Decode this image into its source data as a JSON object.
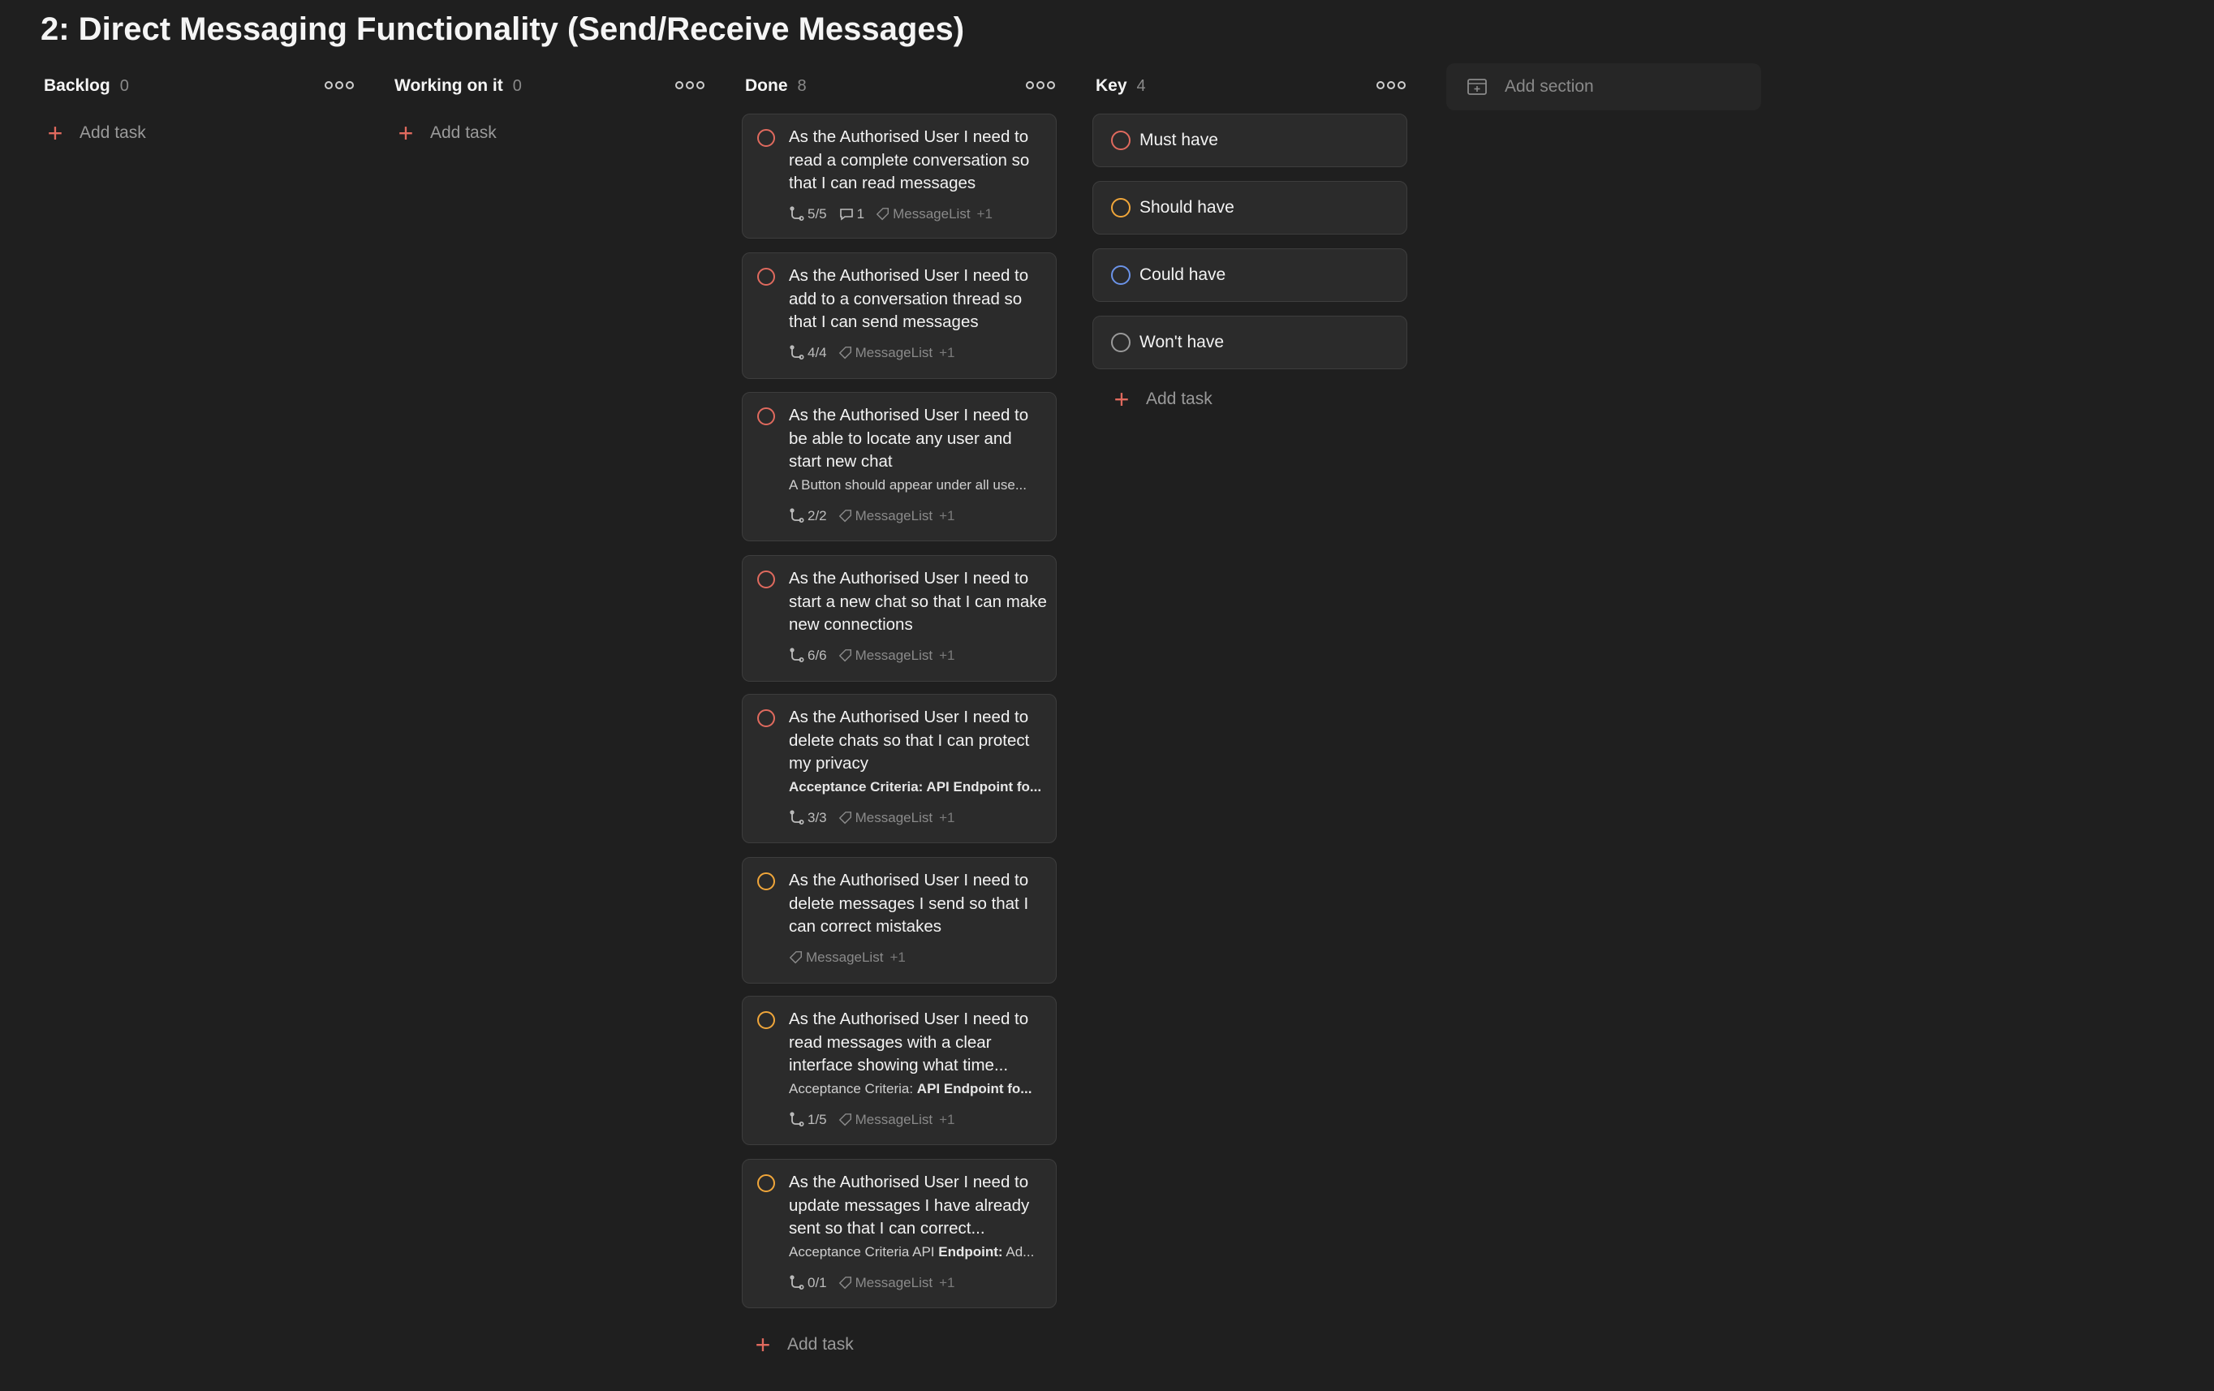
{
  "project": {
    "title": "2: Direct Messaging Functionality (Send/Receive Messages)"
  },
  "add_task_label": "Add task",
  "add_section_label": "Add section",
  "colors": {
    "must": "#e06a5e",
    "should": "#f0a63a",
    "could": "#6b93e8",
    "wont": "#9a9a9a",
    "add_plus": "#e06a5e"
  },
  "columns": [
    {
      "name": "Backlog",
      "count": "0"
    },
    {
      "name": "Working on it",
      "count": "0"
    },
    {
      "name": "Done",
      "count": "8"
    },
    {
      "name": "Key",
      "count": "4"
    }
  ],
  "cards": [
    {
      "title": "As the Authorised User I need to read a complete conversation so that I can read messages",
      "subtasks": "5/5",
      "comments": "1",
      "tag": "MessageList",
      "more": "+1",
      "priority": "must"
    },
    {
      "title": "As the Authorised User I need to add to a conversation thread so that I can send messages",
      "subtasks": "4/4",
      "tag": "MessageList",
      "more": "+1",
      "priority": "must"
    },
    {
      "title": "As the Authorised User I need to be able to locate any user and start new chat",
      "desc": "A Button should appear under all use...",
      "subtasks": "2/2",
      "tag": "MessageList",
      "more": "+1",
      "priority": "must"
    },
    {
      "title": "As the Authorised User I need to start a new chat so that I can make new connections",
      "subtasks": "6/6",
      "tag": "MessageList",
      "more": "+1",
      "priority": "must"
    },
    {
      "title": "As the Authorised User I need to delete chats so that I can protect my privacy",
      "desc_bold": "Acceptance Criteria: API Endpoint fo...",
      "subtasks": "3/3",
      "tag": "MessageList",
      "more": "+1",
      "priority": "must"
    },
    {
      "title": "As the Authorised User I need to delete messages I send so that I can correct mistakes",
      "tag": "MessageList",
      "more": "+1",
      "priority": "should"
    },
    {
      "title": "As the Authorised User I need to read messages with a clear interface showing what time...",
      "desc": "Acceptance Criteria: ",
      "desc_bold": "API Endpoint fo...",
      "subtasks": "1/5",
      "tag": "MessageList",
      "more": "+1",
      "priority": "should"
    },
    {
      "title": "As the Authorised User I need to update messages I have already sent so that I can correct...",
      "desc": "Acceptance Criteria API ",
      "desc_bold": "Endpoint:",
      "desc_tail": " Ad...",
      "subtasks": "0/1",
      "tag": "MessageList",
      "more": "+1",
      "priority": "should"
    }
  ],
  "key": [
    {
      "label": "Must have",
      "priority": "must"
    },
    {
      "label": "Should have",
      "priority": "should"
    },
    {
      "label": "Could have",
      "priority": "could"
    },
    {
      "label": "Won't have",
      "priority": "wont"
    }
  ]
}
